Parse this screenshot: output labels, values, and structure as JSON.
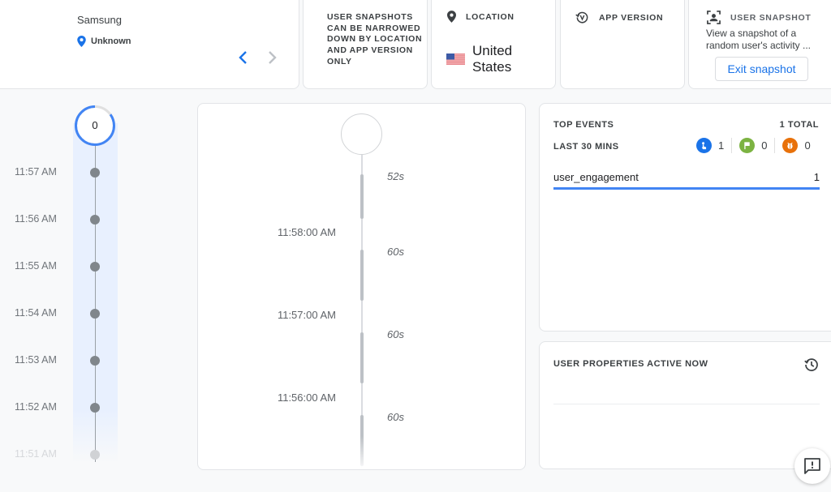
{
  "device": {
    "name": "Samsung",
    "location": "Unknown",
    "location_icon": "map-pin-icon",
    "prev_icon": "chevron-left-icon",
    "next_icon": "chevron-right-icon"
  },
  "hint": {
    "text": "USER SNAPSHOTS CAN BE NARROWED DOWN BY LOCATION AND APP VERSION ONLY"
  },
  "location": {
    "label": "LOCATION",
    "icon": "location-pin-icon",
    "country": "United States",
    "flag_icon": "us-flag-icon"
  },
  "app_version": {
    "label": "APP VERSION",
    "icon": "version-history-icon"
  },
  "snapshot": {
    "label": "USER SNAPSHOT",
    "icon": "user-focus-icon",
    "description": "View a snapshot of a random user's activity ...",
    "exit_label": "Exit snapshot"
  },
  "minute_timeline": {
    "current_count": "0",
    "ring_progress": 0.85,
    "colors": {
      "ring": "#4285f4",
      "ring_track": "#e0e0e0"
    },
    "minutes": [
      {
        "time": "11:57 AM"
      },
      {
        "time": "11:56 AM"
      },
      {
        "time": "11:55 AM"
      },
      {
        "time": "11:54 AM"
      },
      {
        "time": "11:53 AM"
      },
      {
        "time": "11:52 AM"
      },
      {
        "time": "11:51 AM"
      }
    ]
  },
  "session_timeline": {
    "segments": [
      {
        "duration": "52s"
      },
      {
        "duration": "60s"
      },
      {
        "duration": "60s"
      },
      {
        "duration": "60s"
      }
    ],
    "ticks": [
      {
        "time": "11:58:00 AM"
      },
      {
        "time": "11:57:00 AM"
      },
      {
        "time": "11:56:00 AM"
      }
    ]
  },
  "top_events": {
    "title": "TOP EVENTS",
    "total": "1 TOTAL",
    "range": "LAST 30 MINS",
    "counts": [
      {
        "icon": "touch-event-icon",
        "value": "1",
        "color": "#1a73e8"
      },
      {
        "icon": "conversion-flag-icon",
        "value": "0",
        "color": "#7cb342"
      },
      {
        "icon": "error-bug-icon",
        "value": "0",
        "color": "#e8710a"
      }
    ],
    "events": [
      {
        "name": "user_engagement",
        "count": "1"
      }
    ],
    "accent": "#4285f4"
  },
  "user_properties": {
    "title": "USER PROPERTIES ACTIVE NOW",
    "history_icon": "history-icon"
  },
  "feedback": {
    "icon": "feedback-icon"
  }
}
